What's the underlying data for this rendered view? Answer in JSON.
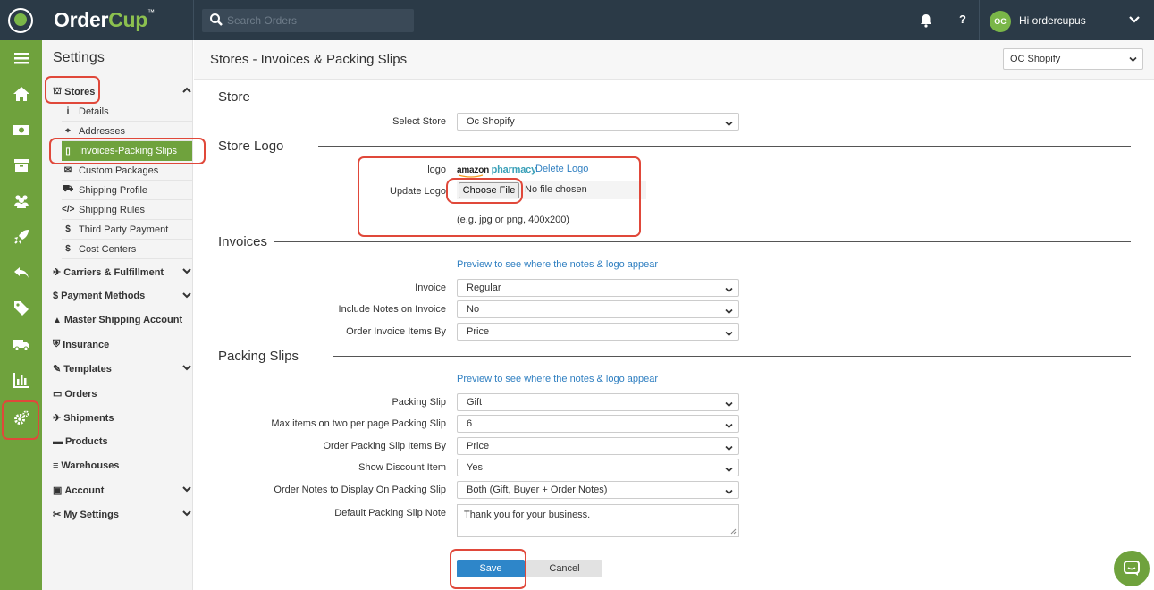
{
  "app": {
    "brand_order": "Order",
    "brand_cup": "Cup",
    "brand_tm": "™",
    "search_placeholder": "Search Orders",
    "help": "?",
    "user_initials": "OC",
    "user_greeting": "Hi ordercupus"
  },
  "rail": {
    "icons": [
      "menu-icon",
      "home-icon",
      "money-icon",
      "archive-icon",
      "users-icon",
      "rocket-icon",
      "reply-icon",
      "tag-icon",
      "truck-icon",
      "chart-icon",
      "settings-cogs-icon"
    ]
  },
  "sidebar": {
    "title": "Settings",
    "stores": "Stores",
    "stores_items": [
      {
        "icon": "i",
        "label": "Details"
      },
      {
        "icon": "⌖",
        "label": "Addresses"
      },
      {
        "icon": "▯",
        "label": "Invoices-Packing Slips"
      },
      {
        "icon": "✉",
        "label": "Custom Packages"
      },
      {
        "icon": "⛟",
        "label": "Shipping Profile"
      },
      {
        "icon": "</>",
        "label": "Shipping Rules"
      },
      {
        "icon": "$",
        "label": "Third Party Payment"
      },
      {
        "icon": "$",
        "label": "Cost Centers"
      }
    ],
    "sections": [
      {
        "icon": "✈",
        "label": "Carriers & Fulfillment"
      },
      {
        "icon": "$",
        "label": "Payment Methods"
      },
      {
        "icon": "🎓",
        "label": "Master Shipping Account"
      },
      {
        "icon": "⛨",
        "label": "Insurance"
      },
      {
        "icon": "✎",
        "label": "Templates"
      },
      {
        "icon": "▭",
        "label": "Orders"
      },
      {
        "icon": "✈",
        "label": "Shipments"
      },
      {
        "icon": "▬",
        "label": "Products"
      },
      {
        "icon": "≡",
        "label": "Warehouses"
      },
      {
        "icon": "▣",
        "label": "Account"
      },
      {
        "icon": "✂",
        "label": "My Settings"
      }
    ]
  },
  "header": {
    "title": "Stores - Invoices & Packing Slips",
    "store_dropdown": "OC Shopify"
  },
  "store": {
    "heading": "Store",
    "select_label": "Select Store",
    "select_value": "Oc Shopify"
  },
  "logo": {
    "heading": "Store Logo",
    "logo_label": "logo",
    "amazon_word": "amazon",
    "pharmacy_word": "pharmacy",
    "delete_link": "Delete Logo",
    "update_label": "Update Logo",
    "choose_file": "Choose File",
    "no_file": "No file chosen",
    "hint": "(e.g. jpg or png, 400x200)"
  },
  "invoices": {
    "heading": "Invoices",
    "preview_link": "Preview to see where the notes & logo appear",
    "fields": [
      {
        "label": "Invoice",
        "value": "Regular"
      },
      {
        "label": "Include Notes on Invoice",
        "value": "No"
      },
      {
        "label": "Order Invoice Items By",
        "value": "Price"
      }
    ]
  },
  "packing": {
    "heading": "Packing Slips",
    "preview_link": "Preview to see where the notes & logo appear",
    "fields": [
      {
        "label": "Packing Slip",
        "value": "Gift"
      },
      {
        "label": "Max items on two per page Packing Slip",
        "value": "6"
      },
      {
        "label": "Order Packing Slip Items By",
        "value": "Price"
      },
      {
        "label": "Show Discount Item",
        "value": "Yes"
      },
      {
        "label": "Order Notes to Display On Packing Slip",
        "value": "Both (Gift, Buyer + Order Notes)"
      }
    ],
    "note_label": "Default Packing Slip Note",
    "note_value": "Thank you for your business."
  },
  "actions": {
    "save": "Save",
    "cancel": "Cancel"
  },
  "colors": {
    "topbar": "#2b3a47",
    "accent_green": "#6fa23d",
    "link_blue": "#2f7fc1",
    "save_blue": "#2e86c9",
    "annotation_red": "#e0483a"
  }
}
